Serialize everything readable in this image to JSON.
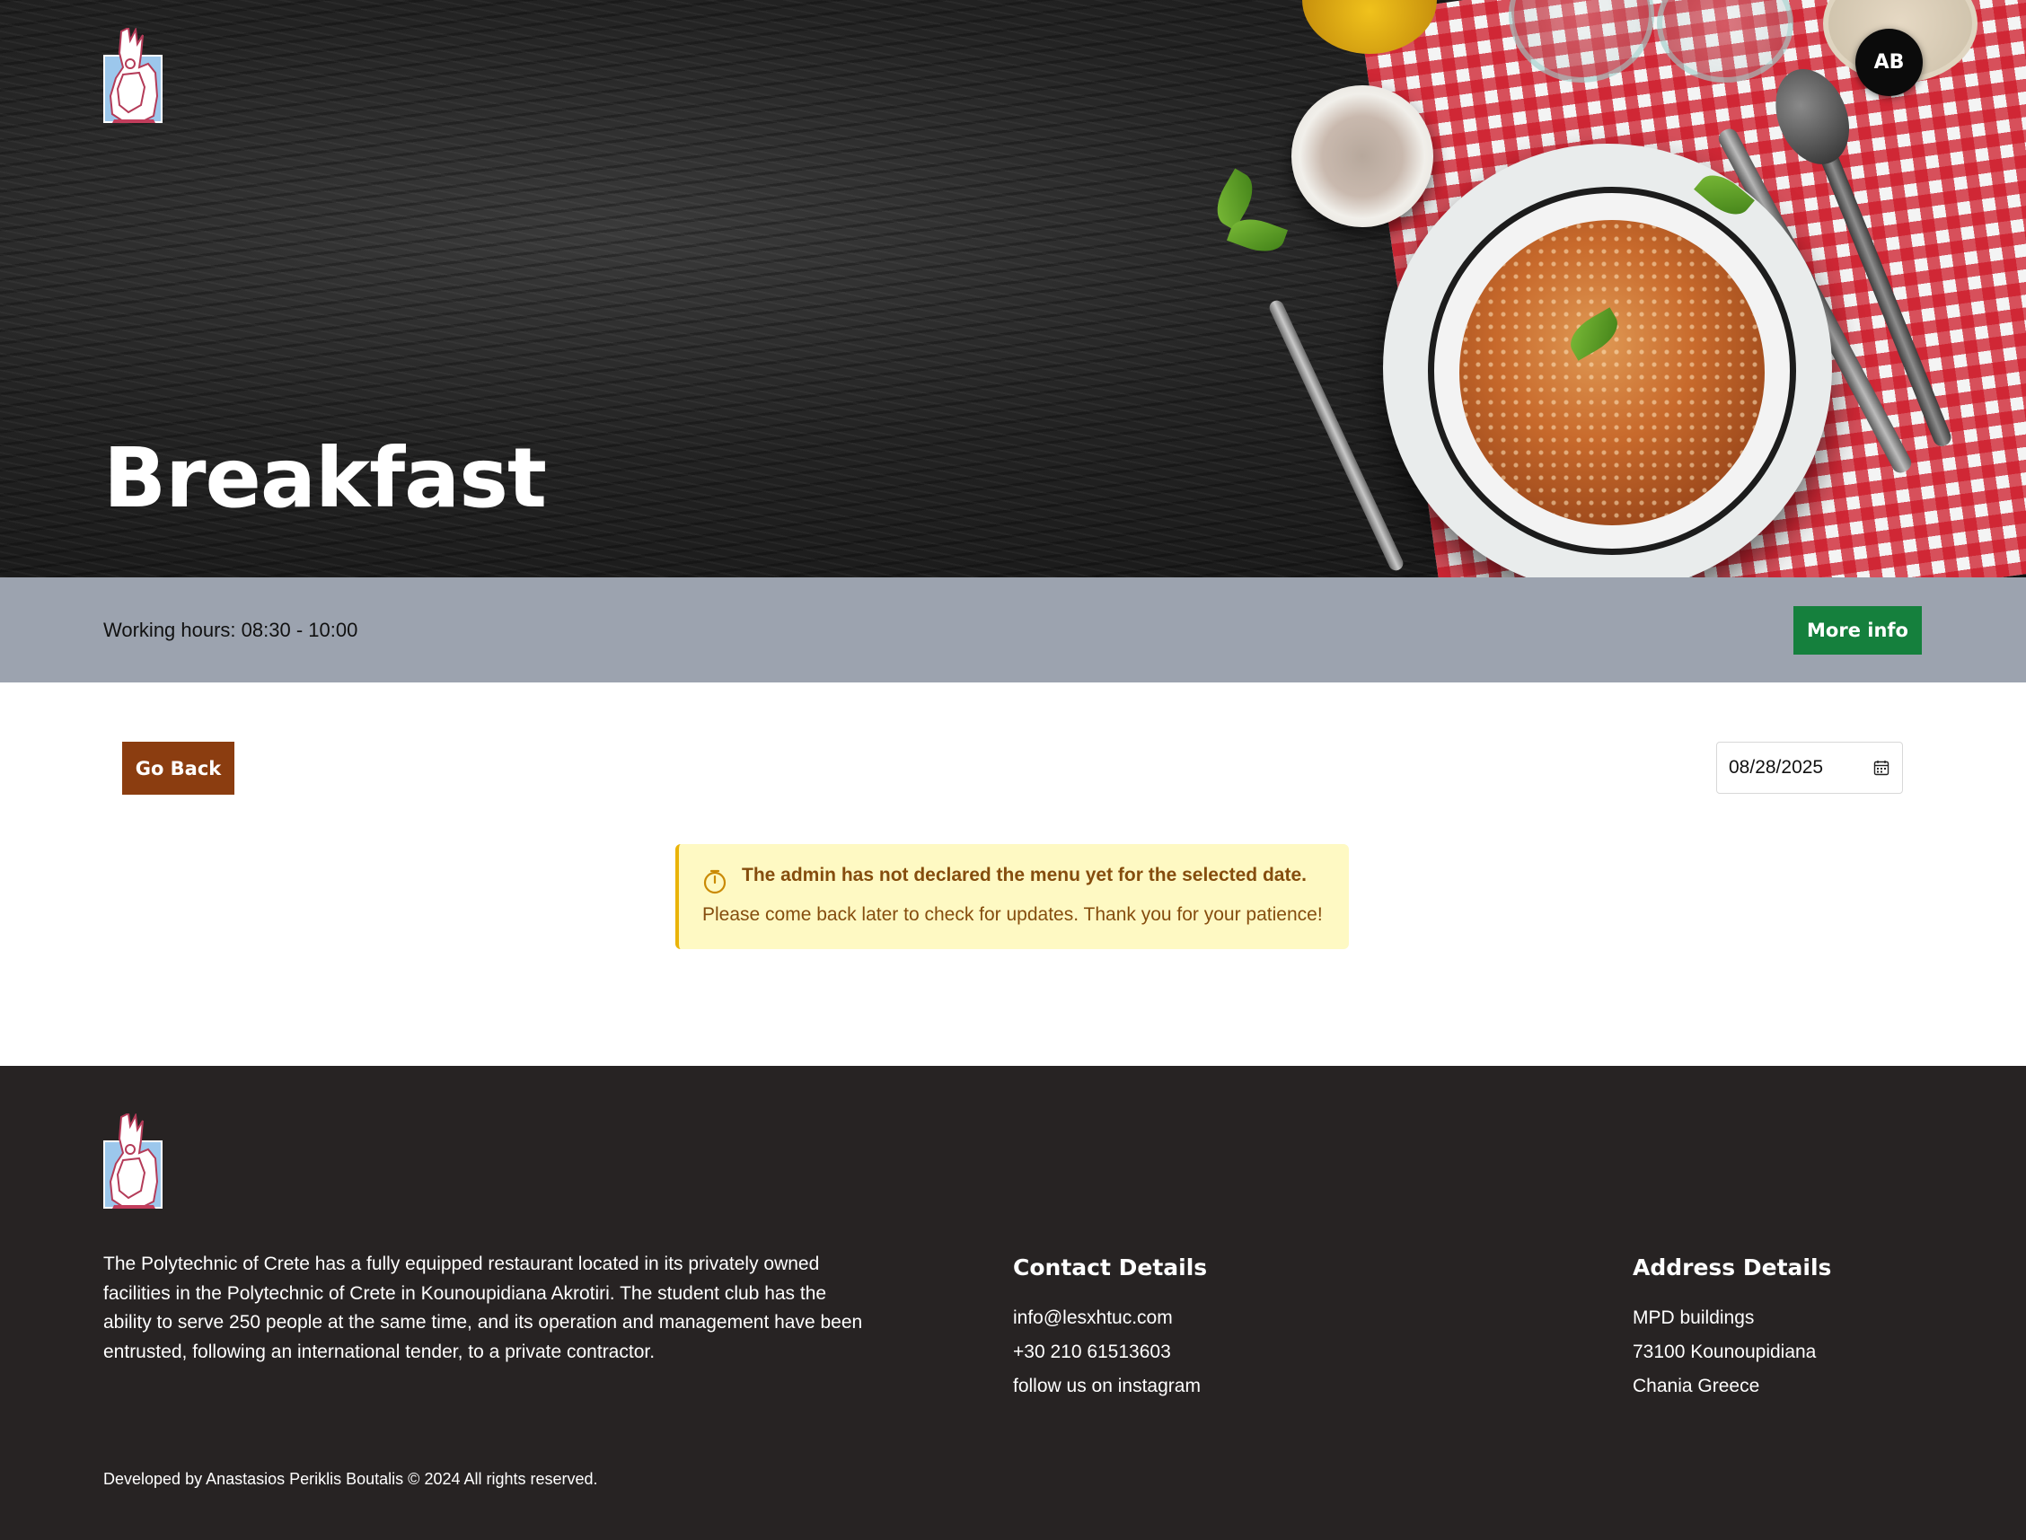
{
  "hero": {
    "title": "Breakfast",
    "avatar_initials": "AB"
  },
  "info_bar": {
    "working_hours": "Working hours: 08:30 - 10:00",
    "more_info_label": "More info",
    "more_info_color": "#15803d"
  },
  "main": {
    "go_back_label": "Go Back",
    "go_back_color": "#8b3d10",
    "date_value": "08/28/2025",
    "alert": {
      "title": "The admin has not declared the menu yet for the selected date.",
      "body": "Please come back later to check for updates. Thank you for your patience!",
      "icon": "timer-icon"
    }
  },
  "footer": {
    "about": "The Polytechnic of Crete has a fully equipped restaurant located in its privately owned facilities in the Polytechnic of Crete in Kounoupidiana Akrotiri. The student club has the ability to serve 250 people at the same time, and its operation and management have been entrusted, following an international tender, to a private contractor.",
    "contact": {
      "heading": "Contact Details",
      "email": "info@lesxhtuc.com",
      "phone": "+30 210 61513603",
      "instagram": "follow us on instagram"
    },
    "address": {
      "heading": "Address Details",
      "line1": "MPD buildings",
      "line2": "73100 Kounoupidiana",
      "line3": "Chania Greece"
    },
    "copyright": "Developed by Anastasios Periklis Boutalis © 2024 All rights reserved."
  }
}
